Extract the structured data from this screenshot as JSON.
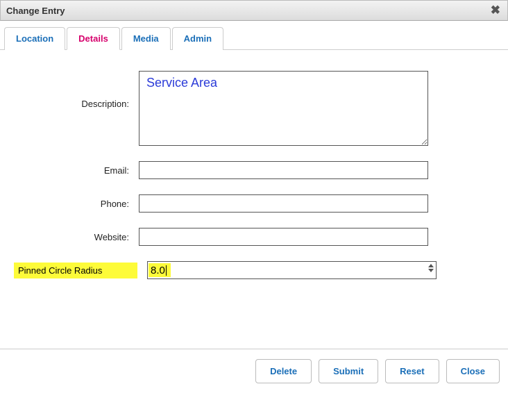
{
  "dialog": {
    "title": "Change Entry"
  },
  "tabs": [
    {
      "label": "Location"
    },
    {
      "label": "Details"
    },
    {
      "label": "Media"
    },
    {
      "label": "Admin"
    }
  ],
  "form": {
    "description": {
      "label": "Description:",
      "value": "Service Area"
    },
    "email": {
      "label": "Email:",
      "value": ""
    },
    "phone": {
      "label": "Phone:",
      "value": ""
    },
    "website": {
      "label": "Website:",
      "value": ""
    },
    "radius": {
      "label": "Pinned Circle Radius",
      "value": "8.0"
    }
  },
  "footer": {
    "delete": "Delete",
    "submit": "Submit",
    "reset": "Reset",
    "close": "Close"
  }
}
